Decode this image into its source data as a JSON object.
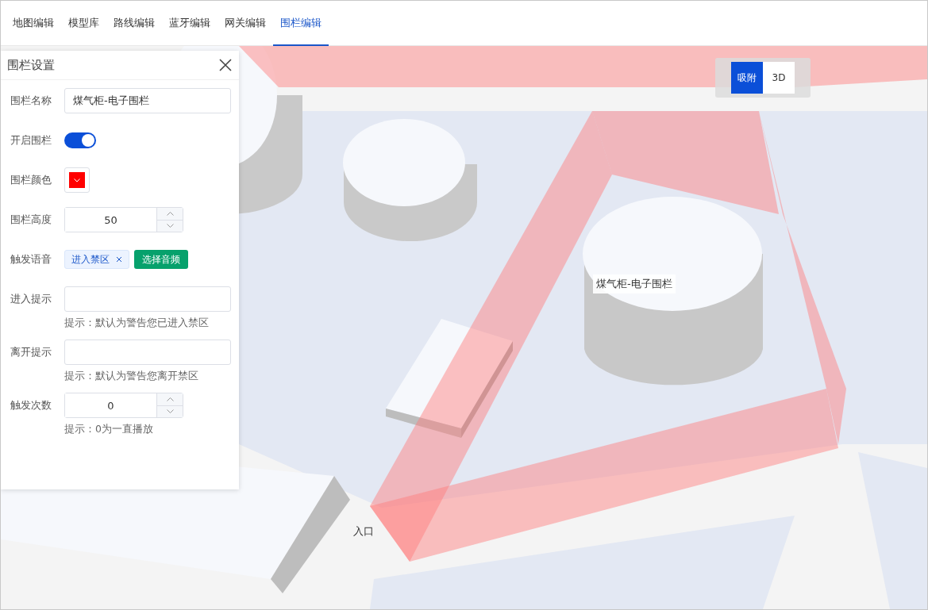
{
  "tabs": [
    {
      "label": "地图编辑",
      "selected": false
    },
    {
      "label": "模型库",
      "selected": false
    },
    {
      "label": "路线编辑",
      "selected": false
    },
    {
      "label": "蓝牙编辑",
      "selected": false
    },
    {
      "label": "网关编辑",
      "selected": false
    },
    {
      "label": "围栏编辑",
      "selected": true
    }
  ],
  "panel": {
    "title": "围栏设置",
    "fields": [
      {
        "kind": "text",
        "label": "围栏名称",
        "value": "煤气柜-电子围栏"
      },
      {
        "kind": "switch",
        "label": "开启围栏",
        "on": true
      },
      {
        "kind": "color",
        "label": "围栏颜色",
        "color": "#ff0000"
      },
      {
        "kind": "number",
        "label": "围栏高度",
        "value": "50"
      },
      {
        "kind": "tags",
        "label": "触发语音",
        "tags": [
          "进入禁区"
        ],
        "button": "选择音频"
      },
      {
        "kind": "text",
        "label": "进入提示",
        "hint": "提示：默认为警告您已进入禁区"
      },
      {
        "kind": "text",
        "label": "离开提示",
        "hint": "提示：默认为警告您离开禁区"
      },
      {
        "kind": "number",
        "label": "触发次数",
        "value": "0",
        "hint": "提示：0为一直播放"
      }
    ]
  },
  "map": {
    "modes": [
      {
        "label": "吸附",
        "selected": true
      },
      {
        "label": "3D",
        "selected": false
      }
    ],
    "labels": [
      "煤气柜-电子围栏",
      "入口"
    ]
  }
}
